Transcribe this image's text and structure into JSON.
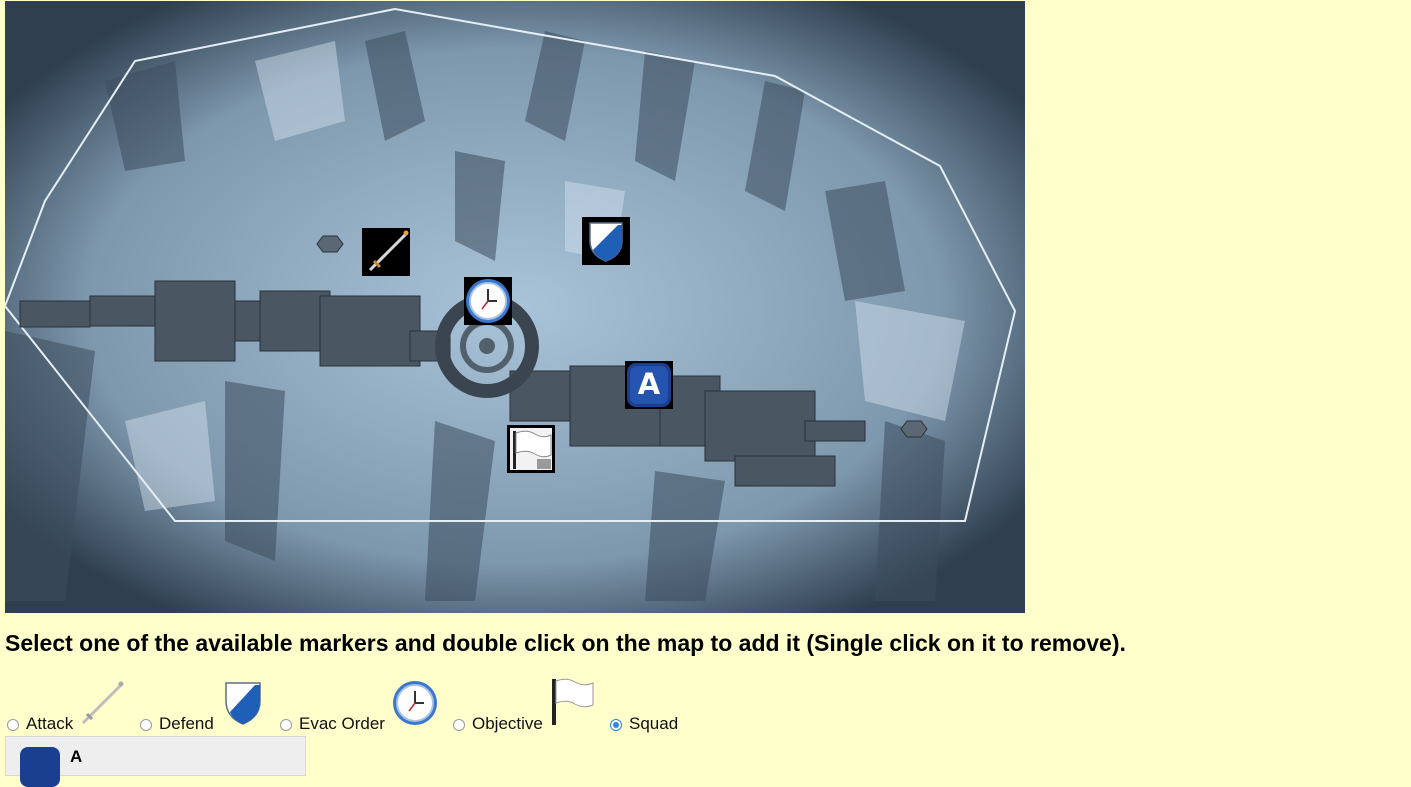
{
  "map": {
    "markers": [
      {
        "type": "attack",
        "icon": "sword-icon"
      },
      {
        "type": "defend",
        "icon": "shield-icon"
      },
      {
        "type": "evac_order",
        "icon": "clock-icon"
      },
      {
        "type": "squad",
        "icon": "squad-a-icon",
        "label": "A"
      },
      {
        "type": "objective",
        "icon": "flag-icon"
      }
    ]
  },
  "instructions": "Select one of the available markers and double click on the map to add it (Single click on it to remove).",
  "marker_options": [
    {
      "label": "Attack",
      "icon": "sword-icon",
      "selected": false
    },
    {
      "label": "Defend",
      "icon": "shield-icon",
      "selected": false
    },
    {
      "label": "Evac Order",
      "icon": "clock-icon",
      "selected": false
    },
    {
      "label": "Objective",
      "icon": "flag-icon",
      "selected": false
    },
    {
      "label": "Squad",
      "icon": null,
      "selected": true
    }
  ],
  "squad_panel": {
    "label": "A",
    "icon": "squad-a-icon"
  },
  "colors": {
    "page_background": "#ffffcc",
    "radio_accent": "#2f86e6",
    "squad_blue": "#1b3f8f"
  }
}
